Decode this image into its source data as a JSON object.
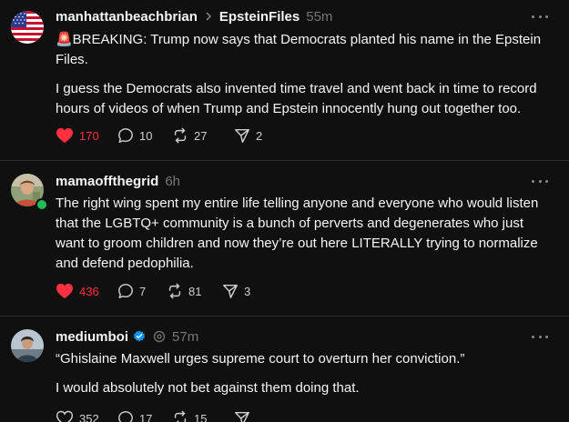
{
  "posts": [
    {
      "username": "manhattanbeachbrian",
      "topic": "EpsteinFiles",
      "time": "55m",
      "avatar_icon": "us-flag-avatar",
      "paragraphs": [
        "🚨BREAKING: Trump now says that Democrats planted his name in the Epstein Files.",
        "I guess the Democrats also invented time travel and went back in time to record hours of videos of when Trump and Epstein innocently hung out together too."
      ],
      "likes": "170",
      "replies": "10",
      "reposts": "27",
      "shares": "2",
      "liked": true
    },
    {
      "username": "mamaoffthegrid",
      "time": "6h",
      "avatar_icon": "person-photo-avatar",
      "online": true,
      "paragraphs": [
        "The right wing spent my entire life telling anyone and everyone who would listen that the LGBTQ+ community is a bunch of perverts and degenerates who just want to groom children and now they’re out here LITERALLY trying to normalize and defend pedophilia."
      ],
      "likes": "436",
      "replies": "7",
      "reposts": "81",
      "shares": "3",
      "liked": true
    },
    {
      "username": "mediumboi",
      "time": "57m",
      "avatar_icon": "person-photo-avatar",
      "verified": true,
      "paragraphs": [
        "“Ghislaine Maxwell urges supreme court to overturn her conviction.”",
        "I would absolutely not bet against them doing that."
      ],
      "likes": "352",
      "replies": "17",
      "reposts": "15",
      "shares": "",
      "liked": false
    }
  ],
  "colors": {
    "background": "#101010",
    "text": "#f3f5f7",
    "muted": "#777777",
    "like_red": "#ff3040",
    "verified_blue": "#0095f6",
    "online_green": "#1fbd5a",
    "divider": "#2d2d2d"
  }
}
